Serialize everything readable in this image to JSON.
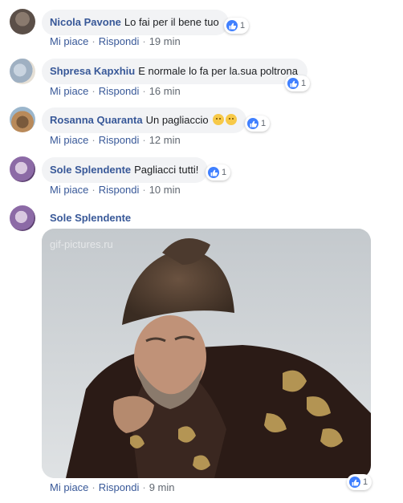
{
  "comments": [
    {
      "name": "Nicola Pavone",
      "text": "Lo fai per il bene tuo",
      "actions": {
        "like": "Mi piace",
        "reply": "Rispondi",
        "time": "19 min"
      },
      "reaction_count": "1"
    },
    {
      "name": "Shpresa Kapxhiu",
      "text": "E normale lo fa per la.sua poltrona",
      "actions": {
        "like": "Mi piace",
        "reply": "Rispondi",
        "time": "16 min"
      },
      "reaction_count": "1"
    },
    {
      "name": "Rosanna Quaranta",
      "text": "Un pagliaccio",
      "actions": {
        "like": "Mi piace",
        "reply": "Rispondi",
        "time": "12 min"
      },
      "reaction_count": "1"
    },
    {
      "name": "Sole Splendente",
      "text": "Pagliacci tutti!",
      "actions": {
        "like": "Mi piace",
        "reply": "Rispondi",
        "time": "10 min"
      },
      "reaction_count": "1"
    },
    {
      "name": "Sole Splendente",
      "gif_watermark": "gif-pictures.ru",
      "actions": {
        "like": "Mi piace",
        "reply": "Rispondi",
        "time": "9 min"
      },
      "reaction_count": "1"
    }
  ],
  "separator": "·",
  "colors": {
    "link": "#385898",
    "bubble": "#f2f3f5",
    "like_blue": "#4080ff"
  }
}
